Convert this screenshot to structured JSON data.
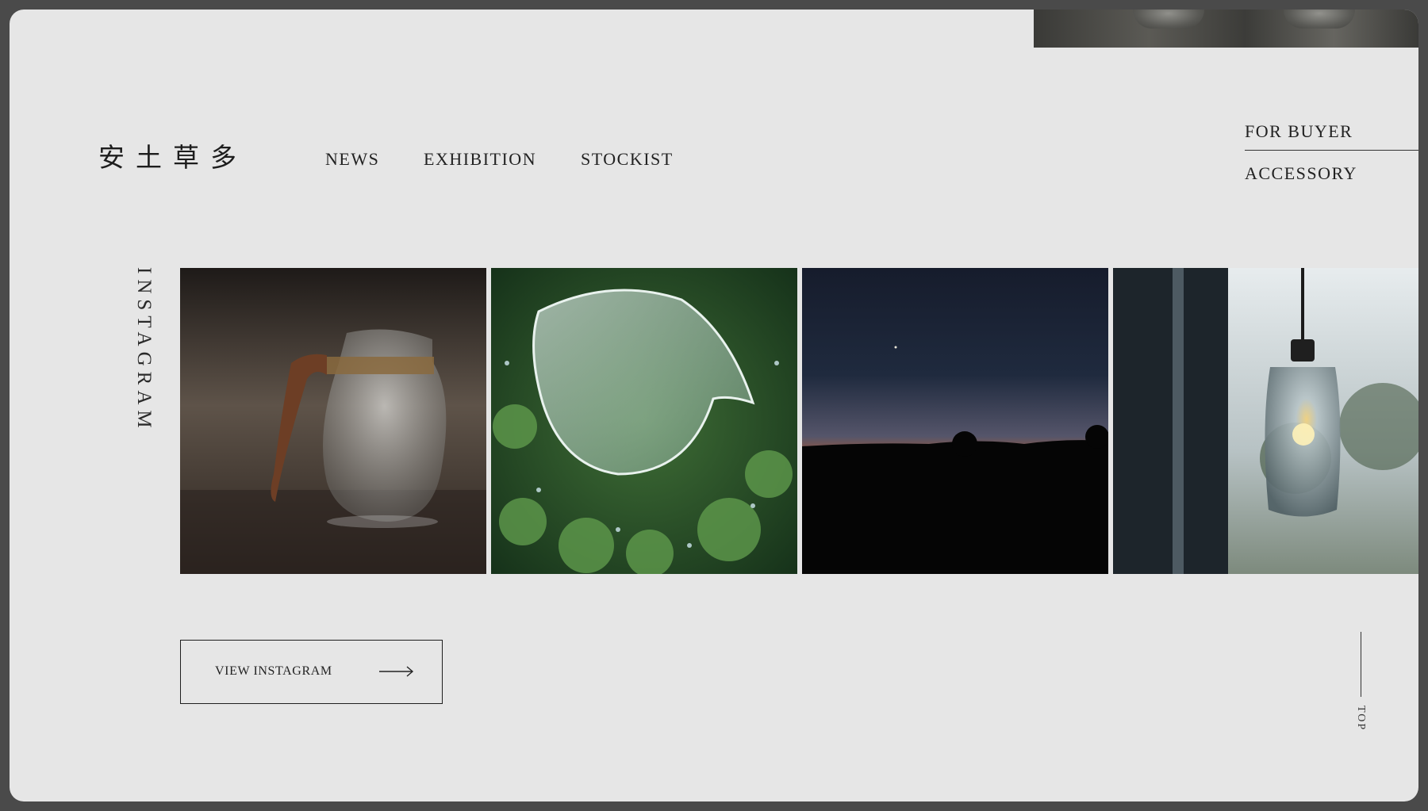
{
  "brand": {
    "name": "安土草多"
  },
  "nav": {
    "items": [
      "NEWS",
      "EXHIBITION",
      "STOCKIST"
    ]
  },
  "sub_nav": {
    "for_buyer": "FOR BUYER",
    "accessory": "ACCESSORY"
  },
  "instagram": {
    "section_label": "INSTAGRAM",
    "button_label": "VIEW INSTAGRAM",
    "tiles": [
      {
        "subject": "glass pitcher with wooden handle"
      },
      {
        "subject": "bubbled glass bowl on greenery"
      },
      {
        "subject": "sunset sky silhouette"
      },
      {
        "subject": "glass pendant lamp"
      }
    ]
  },
  "back_to_top": {
    "label": "TOP"
  },
  "colors": {
    "background": "#e6e6e6",
    "text": "#222222",
    "frame": "#4a4a4a"
  }
}
